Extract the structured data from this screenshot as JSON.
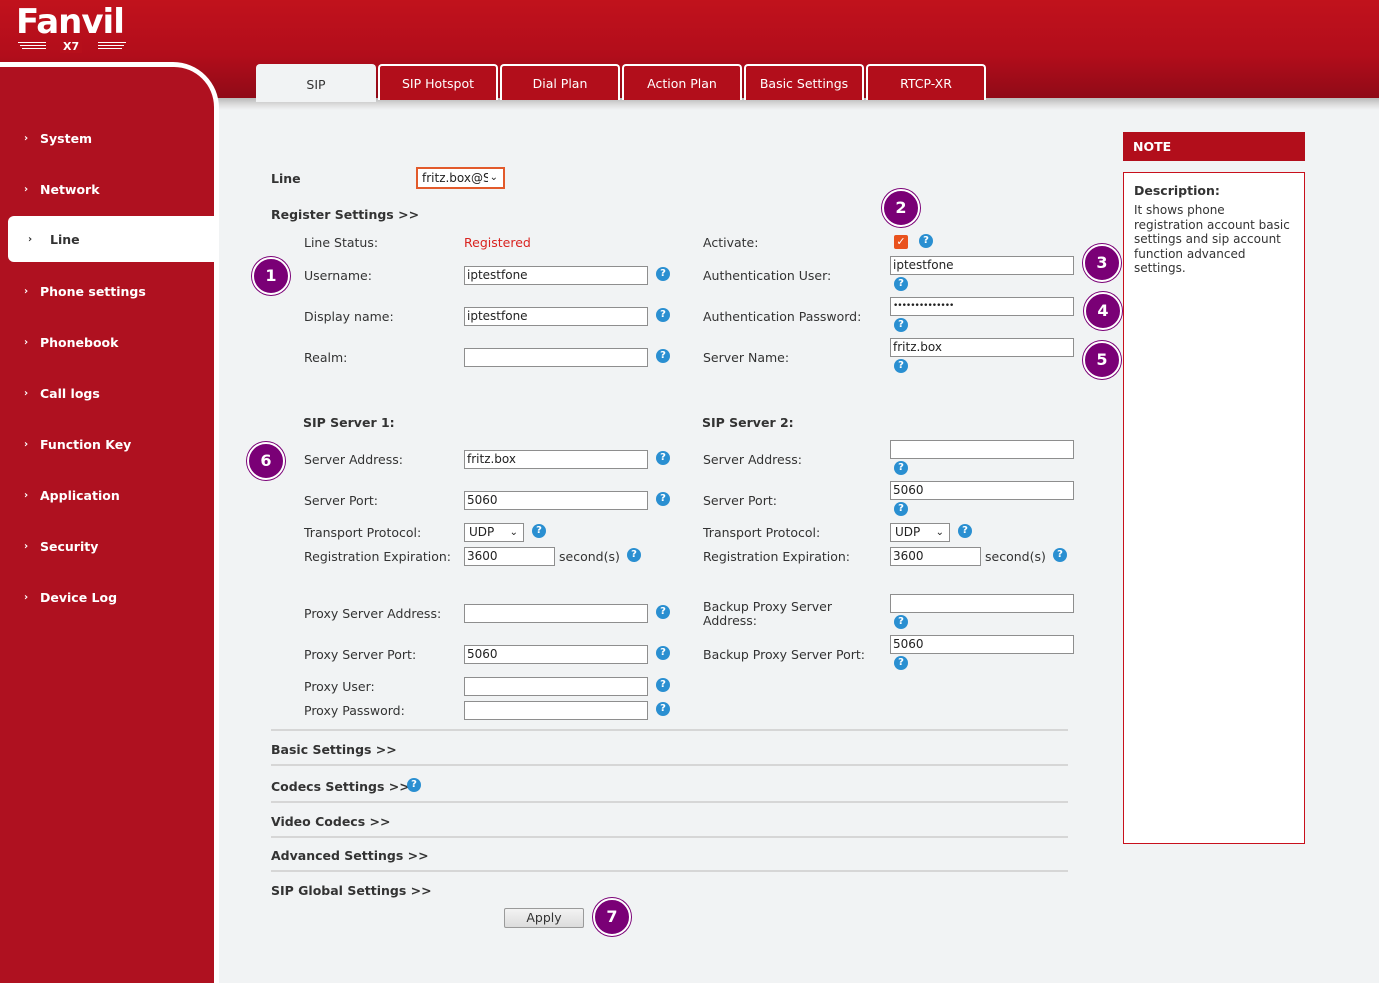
{
  "brand": {
    "name": "Fanvil",
    "model": "X7"
  },
  "sidebar": {
    "items": [
      {
        "label": "System"
      },
      {
        "label": "Network"
      },
      {
        "label": "Line"
      },
      {
        "label": "Phone settings"
      },
      {
        "label": "Phonebook"
      },
      {
        "label": "Call logs"
      },
      {
        "label": "Function Key"
      },
      {
        "label": "Application"
      },
      {
        "label": "Security"
      },
      {
        "label": "Device Log"
      }
    ],
    "active": "Line"
  },
  "tabs": [
    {
      "label": "SIP"
    },
    {
      "label": "SIP Hotspot"
    },
    {
      "label": "Dial Plan"
    },
    {
      "label": "Action Plan"
    },
    {
      "label": "Basic Settings"
    },
    {
      "label": "RTCP-XR"
    }
  ],
  "line": {
    "label": "Line",
    "value": "fritz.box@S"
  },
  "register": {
    "title": "Register Settings >>",
    "line_status_label": "Line Status:",
    "line_status_value": "Registered",
    "activate_label": "Activate:",
    "activate_checked": true,
    "username_label": "Username:",
    "username_value": "iptestfone",
    "auth_user_label": "Authentication User:",
    "auth_user_value": "iptestfone",
    "display_name_label": "Display name:",
    "display_name_value": "iptestfone",
    "auth_password_label": "Authentication Password:",
    "auth_password_value": "••••••••••••••",
    "realm_label": "Realm:",
    "realm_value": "",
    "server_name_label": "Server Name:",
    "server_name_value": "fritz.box"
  },
  "sip1": {
    "title": "SIP Server 1:",
    "address_label": "Server Address:",
    "address_value": "fritz.box",
    "port_label": "Server Port:",
    "port_value": "5060",
    "transport_label": "Transport Protocol:",
    "transport_value": "UDP",
    "expiration_label": "Registration Expiration:",
    "expiration_value": "3600",
    "unit": "second(s)"
  },
  "sip2": {
    "title": "SIP Server 2:",
    "address_label": "Server Address:",
    "address_value": "",
    "port_label": "Server Port:",
    "port_value": "5060",
    "transport_label": "Transport Protocol:",
    "transport_value": "UDP",
    "expiration_label": "Registration Expiration:",
    "expiration_value": "3600",
    "unit": "second(s)"
  },
  "proxy": {
    "address_label": "Proxy Server Address:",
    "address_value": "",
    "port_label": "Proxy Server Port:",
    "port_value": "5060",
    "user_label": "Proxy User:",
    "user_value": "",
    "password_label": "Proxy Password:",
    "password_value": "",
    "backup_address_label_1": "Backup Proxy Server",
    "backup_address_label_2": "Address:",
    "backup_address_value": "",
    "backup_port_label": "Backup Proxy Server Port:",
    "backup_port_value": "5060"
  },
  "sections": [
    {
      "label": "Basic Settings >>"
    },
    {
      "label": "Codecs Settings >>"
    },
    {
      "label": "Video Codecs >>"
    },
    {
      "label": "Advanced Settings >>"
    },
    {
      "label": "SIP Global Settings >>"
    }
  ],
  "apply_label": "Apply",
  "help_glyph": "?",
  "badges": [
    "1",
    "2",
    "3",
    "4",
    "5",
    "6",
    "7"
  ],
  "note": {
    "header": "NOTE",
    "title": "Description:",
    "text": "It shows phone registration account basic settings and sip account function advanced settings."
  },
  "colors": {
    "brand_red": "#b20e1b",
    "badge_purple": "#7a0076",
    "help_blue": "#2a8fd1",
    "status_red": "#d9231f"
  }
}
